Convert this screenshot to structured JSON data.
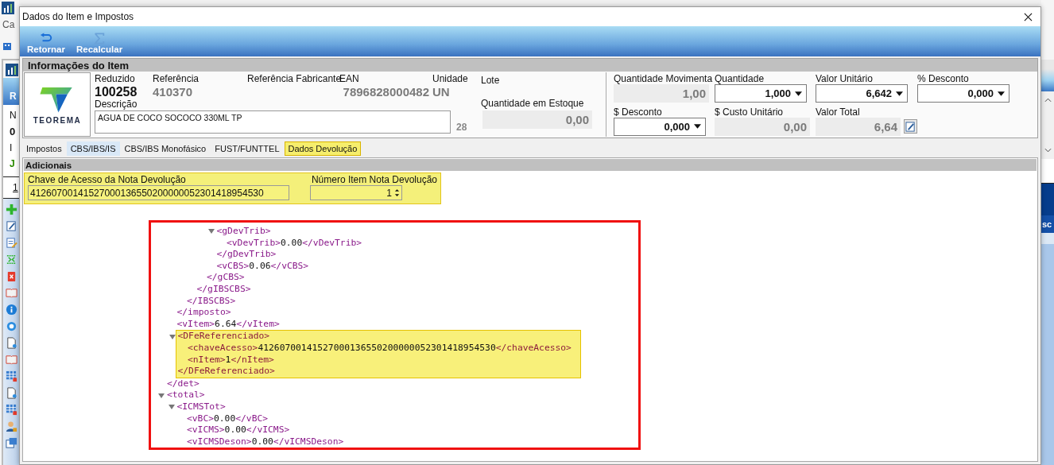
{
  "background_app": {
    "left_fragments": [
      {
        "text": "Ca",
        "kind": "menu"
      },
      {
        "text": "R",
        "kind": "header"
      },
      {
        "text": "N",
        "kind": "label"
      },
      {
        "text": "0",
        "kind": "number"
      },
      {
        "text": "I",
        "kind": "label"
      },
      {
        "text": "J",
        "kind": "status"
      },
      {
        "text": "1",
        "kind": "tab"
      }
    ],
    "right_fragment": "sc"
  },
  "window": {
    "title": "Dados do Item e Impostos"
  },
  "toolbar": [
    {
      "label": "Retornar",
      "kind": "undo"
    },
    {
      "label": "Recalcular",
      "kind": "sigma"
    }
  ],
  "item_panel": {
    "title": "Informações do Item",
    "logo_text": "TEOREMA",
    "reduzido_label": "Reduzido",
    "reduzido": "100258",
    "referencia_label": "Referência",
    "referencia": "410370",
    "ref_fabricante_label": "Referência Fabricante",
    "ean_label": "EAN",
    "ean": "7896828000482",
    "unidade_label": "Unidade",
    "unidade": "UN",
    "lote_label": "Lote",
    "descricao_label": "Descrição",
    "descricao": "AGUA DE COCO SOCOCO 330ML TP",
    "descricao_count": "28",
    "estoque_label": "Quantidade em Estoque",
    "estoque": "0,00"
  },
  "values": [
    {
      "label": "Quantidade Movimenta",
      "value": "1,00",
      "kind": "readonly"
    },
    {
      "label": "Quantidade",
      "value": "1,000",
      "kind": "dropdown"
    },
    {
      "label": "Valor Unitário",
      "value": "6,642",
      "kind": "dropdown"
    },
    {
      "label": "% Desconto",
      "value": "0,000",
      "kind": "dropdown"
    },
    {
      "label": "$ Desconto",
      "value": "0,000",
      "kind": "dropdown"
    },
    {
      "label": "$ Custo Unitário",
      "value": "0,00",
      "kind": "readonly"
    },
    {
      "label": "Valor Total",
      "value": "6,64",
      "kind": "readonly_edit"
    }
  ],
  "tabs": [
    {
      "label": "Impostos",
      "selected": false,
      "highlighted": false
    },
    {
      "label": "CBS/IBS/IS",
      "selected": false,
      "highlighted": true
    },
    {
      "label": "CBS/IBS Monofásico",
      "selected": false,
      "highlighted": false
    },
    {
      "label": "FUST/FUNTTEL",
      "selected": false,
      "highlighted": false
    },
    {
      "label": "Dados Devolução",
      "selected": true,
      "highlighted": false
    }
  ],
  "additional": {
    "title": "Adicionais",
    "chave_label": "Chave de Acesso da Nota Devolução",
    "chave": "41260700141527000136550200000052301418954530",
    "numero_label": "Número Item Nota Devolução",
    "numero": "1"
  },
  "xml": {
    "nodes": [
      {
        "close": "</det>",
        "children": [
          {
            "close": "</imposto>",
            "children": [
              {
                "close": "</IBSCBS>",
                "children": [
                  {
                    "close": "</gIBSCBS>",
                    "children": [
                      {
                        "close": "</gCBS>",
                        "children": [
                          {
                            "open": "<gDevTrib>",
                            "expanded": true,
                            "close": "</gDevTrib>",
                            "children": [
                              {
                                "open": "<vDevTrib>",
                                "value": "0.00",
                                "close": "</vDevTrib>"
                              }
                            ]
                          },
                          {
                            "open": "<vCBS>",
                            "value": "0.06",
                            "close": "</vCBS>"
                          }
                        ]
                      }
                    ]
                  }
                ]
              }
            ]
          },
          {
            "open": "<vItem>",
            "value": "6.64",
            "close": "</vItem>"
          },
          {
            "open": "<DFeReferenciado>",
            "expanded": true,
            "highlighted": true,
            "close": "</DFeReferenciado>",
            "children": [
              {
                "open": "<chaveAcesso>",
                "value": "41260700141527000136550200000052301418954530",
                "close": "</chaveAcesso>"
              },
              {
                "open": "<nItem>",
                "value": "1",
                "close": "</nItem>"
              }
            ]
          }
        ]
      },
      {
        "open": "<total>",
        "expanded": true,
        "children": [
          {
            "open": "<ICMSTot>",
            "expanded": true,
            "children": [
              {
                "open": "<vBC>",
                "value": "0.00",
                "close": "</vBC>"
              },
              {
                "open": "<vICMS>",
                "value": "0.00",
                "close": "</vICMS>"
              },
              {
                "open": "<vICMSDeson>",
                "value": "0.00",
                "close": "</vICMSDeson>"
              }
            ]
          }
        ]
      }
    ]
  }
}
